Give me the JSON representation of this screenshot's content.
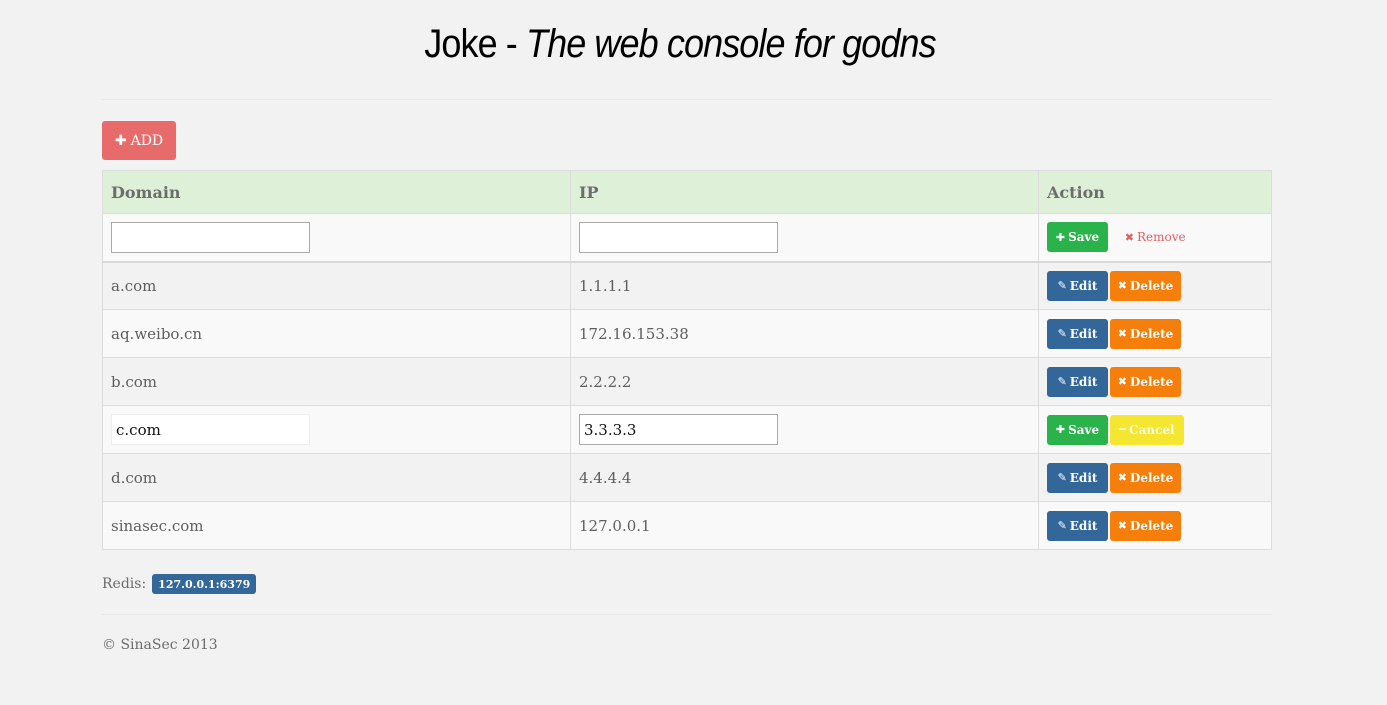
{
  "header": {
    "title_plain": "Joke - ",
    "title_italic": "The web console for godns"
  },
  "toolbar": {
    "add_label": "ADD",
    "add_icon": "plus-icon"
  },
  "table": {
    "columns": [
      "Domain",
      "IP",
      "Action"
    ],
    "new_row": {
      "domain_value": "",
      "ip_value": "",
      "save_label": "Save",
      "remove_label": "Remove"
    },
    "rows": [
      {
        "domain": "a.com",
        "ip": "1.1.1.1",
        "mode": "view"
      },
      {
        "domain": "aq.weibo.cn",
        "ip": "172.16.153.38",
        "mode": "view"
      },
      {
        "domain": "b.com",
        "ip": "2.2.2.2",
        "mode": "view"
      },
      {
        "domain": "c.com",
        "ip": "3.3.3.3",
        "mode": "edit"
      },
      {
        "domain": "d.com",
        "ip": "4.4.4.4",
        "mode": "view"
      },
      {
        "domain": "sinasec.com",
        "ip": "127.0.0.1",
        "mode": "view"
      }
    ],
    "labels": {
      "edit": "Edit",
      "delete": "Delete",
      "save": "Save",
      "cancel": "Cancel"
    }
  },
  "status": {
    "redis_label": "Redis:",
    "redis_address": "127.0.0.1:6379"
  },
  "footer": {
    "copyright": "© SinaSec 2013"
  },
  "colors": {
    "background": "#f2f2f2",
    "header_row": "#dff0d8",
    "add_button": "#e86b6b",
    "save": "#2ab24b",
    "edit": "#336699",
    "delete": "#f57f0a",
    "cancel": "#f4e631",
    "remove_text": "#e06060"
  }
}
